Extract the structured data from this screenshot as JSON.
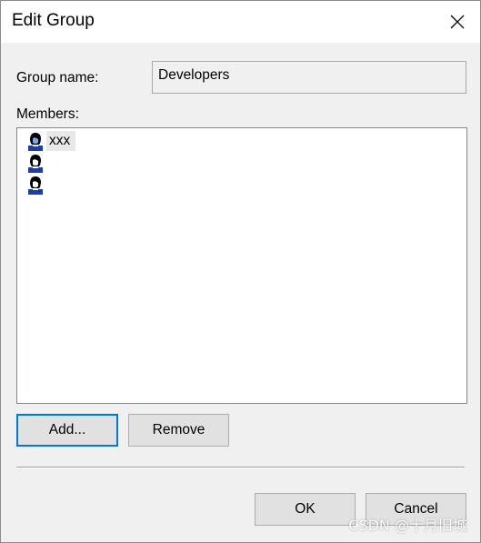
{
  "window": {
    "title": "Edit Group"
  },
  "form": {
    "group_name_label": "Group name:",
    "group_name_value": "Developers",
    "members_label": "Members:"
  },
  "members": [
    {
      "name": "xxx"
    },
    {
      "name": ""
    },
    {
      "name": ""
    }
  ],
  "buttons": {
    "add_label": "Add...",
    "remove_label": "Remove",
    "ok_label": "OK",
    "cancel_label": "Cancel"
  },
  "watermark": {
    "text": "CSDN @十月旧城"
  },
  "colors": {
    "default_button_border": "#0078d7",
    "dialog_background": "#f0f0f0"
  },
  "icons": {
    "close": "close-icon",
    "member": "user-icon"
  }
}
